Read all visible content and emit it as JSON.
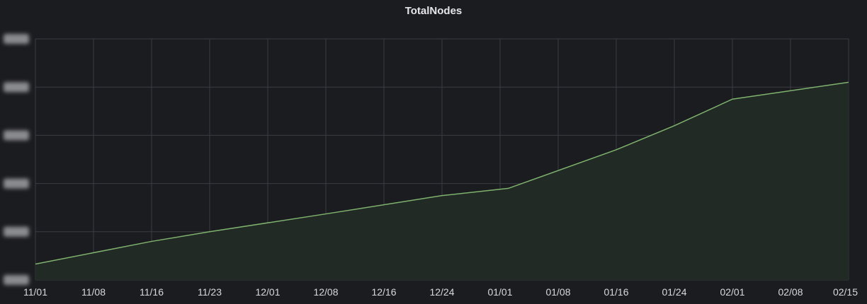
{
  "panel": {
    "title": "TotalNodes"
  },
  "colors": {
    "background": "#1b1c20",
    "grid": "#3a3c42",
    "series_line": "#7eb26d",
    "series_fill": "#222a25",
    "text": "#d8d9da"
  },
  "chart_data": {
    "type": "area",
    "title": "TotalNodes",
    "xlabel": "",
    "ylabel": "",
    "x_ticks": [
      "11/01",
      "11/08",
      "11/16",
      "11/23",
      "12/01",
      "12/08",
      "12/16",
      "12/24",
      "01/01",
      "01/08",
      "01/16",
      "01/24",
      "02/01",
      "02/08",
      "02/15"
    ],
    "y_tick_count": 6,
    "y_tick_labels_visible": false,
    "ylim": [
      0,
      5
    ],
    "grid": true,
    "legend": "none",
    "series": [
      {
        "x": [
          "11/01",
          "11/16",
          "11/23",
          "12/08",
          "12/24",
          "01/02",
          "01/16",
          "01/24",
          "02/01",
          "02/15"
        ],
        "values": [
          0.33,
          0.8,
          1.0,
          1.37,
          1.75,
          1.9,
          2.7,
          3.2,
          3.75,
          4.1
        ]
      }
    ]
  }
}
